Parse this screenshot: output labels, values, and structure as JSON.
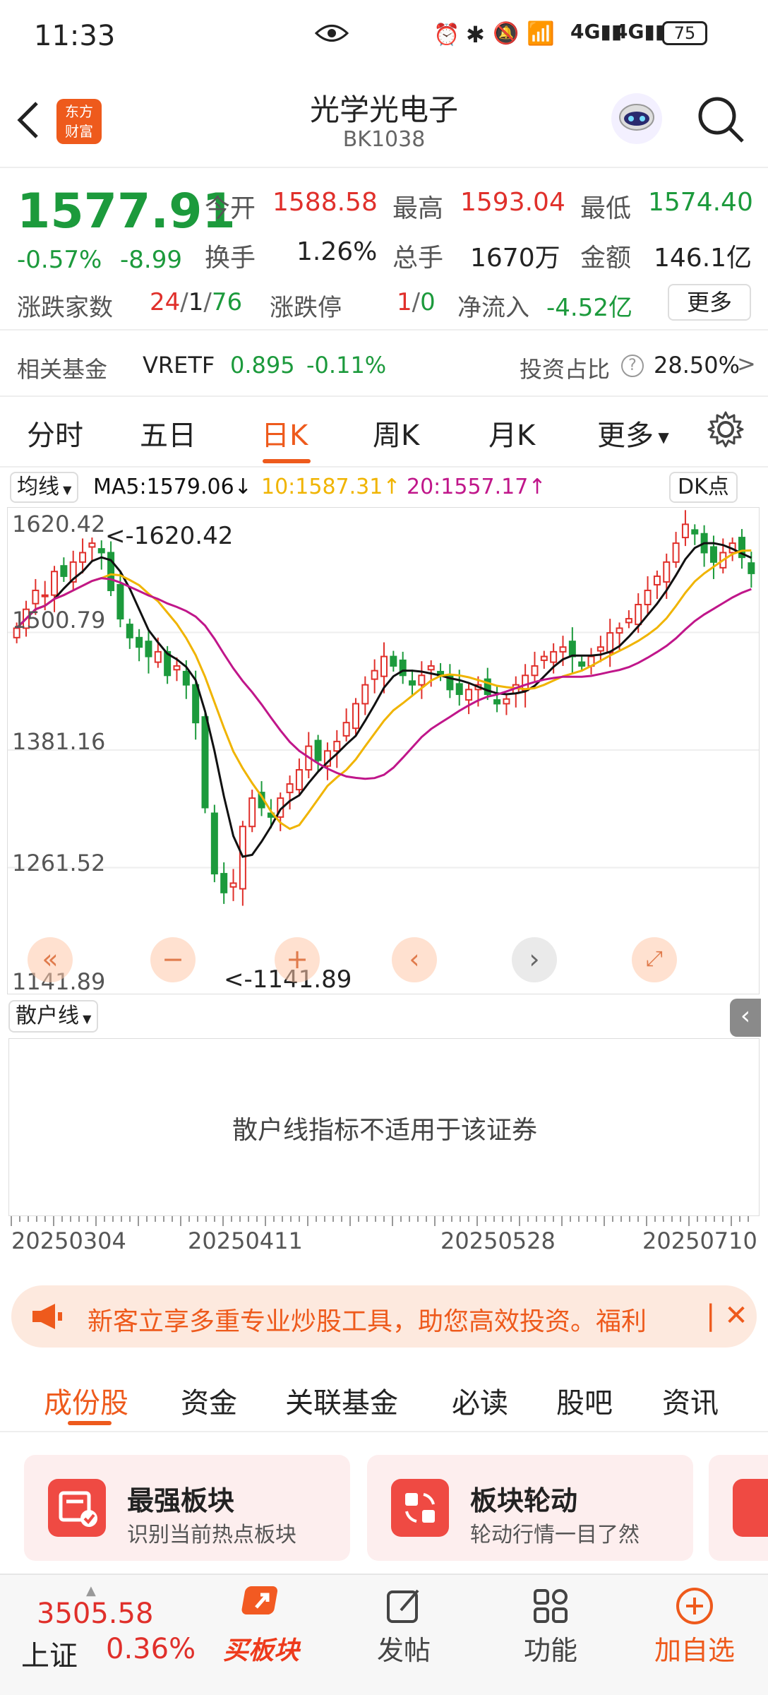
{
  "status_bar": {
    "time": "11:33",
    "battery": "75"
  },
  "header": {
    "logo_text_1": "东方",
    "logo_text_2": "财富",
    "title": "光学光电子",
    "code": "BK1038"
  },
  "quote": {
    "price": "1577.91",
    "change_pct": "-0.57%",
    "change": "-8.99",
    "open_label": "今开",
    "open": "1588.58",
    "high_label": "最高",
    "high": "1593.04",
    "low_label": "最低",
    "low": "1574.40",
    "turnover_label": "换手",
    "turnover": "1.26%",
    "volume_label": "总手",
    "volume": "1670万",
    "amount_label": "金额",
    "amount": "146.1亿",
    "updown_label": "涨跌家数",
    "up": "24",
    "flat": "1",
    "down": "76",
    "limit_label": "涨跌停",
    "limit_up": "1",
    "limit_down": "0",
    "inflow_label": "净流入",
    "inflow": "-4.52亿",
    "more_label": "更多"
  },
  "fund": {
    "label": "相关基金",
    "name": "VRETF",
    "price": "0.895",
    "pct": "-0.11%",
    "ratio_label": "投资占比",
    "ratio": "28.50%",
    "arrow": ">"
  },
  "period_tabs": [
    "分时",
    "五日",
    "日K",
    "周K",
    "月K",
    "更多"
  ],
  "active_period": "日K",
  "ma_bar": {
    "selector": "均线",
    "ma5": "MA5:1579.06",
    "ma10": "10:1587.31",
    "ma20": "20:1557.17",
    "dk": "DK点"
  },
  "chart_data": {
    "type": "candlestick",
    "y_ticks": [
      "1620.42",
      "1500.79",
      "1381.16",
      "1261.52",
      "1141.89"
    ],
    "max_marker": "<-1620.42",
    "min_marker": "<-1141.89",
    "x_ticks": [
      "20250304",
      "20250411",
      "20250528",
      "20250710"
    ],
    "ylim": [
      1141.89,
      1640
    ],
    "closes": [
      1520,
      1540,
      1560,
      1555,
      1580,
      1575,
      1590,
      1600,
      1610,
      1600,
      1560,
      1530,
      1510,
      1500,
      1490,
      1495,
      1470,
      1480,
      1460,
      1420,
      1330,
      1260,
      1240,
      1250,
      1310,
      1340,
      1330,
      1320,
      1340,
      1355,
      1370,
      1395,
      1380,
      1390,
      1400,
      1420,
      1440,
      1460,
      1475,
      1490,
      1480,
      1470,
      1460,
      1470,
      1480,
      1470,
      1455,
      1450,
      1455,
      1460,
      1450,
      1440,
      1445,
      1460,
      1470,
      1480,
      1490,
      1495,
      1500,
      1490,
      1480,
      1490,
      1500,
      1515,
      1520,
      1530,
      1545,
      1560,
      1575,
      1590,
      1610,
      1630,
      1620,
      1600,
      1590,
      1600,
      1610,
      1595,
      1578
    ],
    "series_colors": {
      "ma5": "#111111",
      "ma10": "#f0b400",
      "ma20": "#c0168a"
    }
  },
  "indicator": {
    "selector": "散户线",
    "message": "散户线指标不适用于该证券"
  },
  "banner": {
    "text": "新客立享多重专业炒股工具，助您高效投资。福利"
  },
  "section_tabs": [
    "成份股",
    "资金",
    "关联基金",
    "必读",
    "股吧",
    "资讯"
  ],
  "active_section": "成份股",
  "cards": [
    {
      "title": "最强板块",
      "subtitle": "识别当前热点板块"
    },
    {
      "title": "板块轮动",
      "subtitle": "轮动行情一目了然"
    }
  ],
  "bottom_bar": {
    "index_value": "3505.58",
    "index_name": "上证",
    "index_pct": "0.36%",
    "buy_label": "买板块",
    "post_label": "发帖",
    "func_label": "功能",
    "add_label": "加自选"
  },
  "colors": {
    "accent": "#ee5a1c",
    "up": "#e0302b",
    "down": "#1c9a3c"
  }
}
